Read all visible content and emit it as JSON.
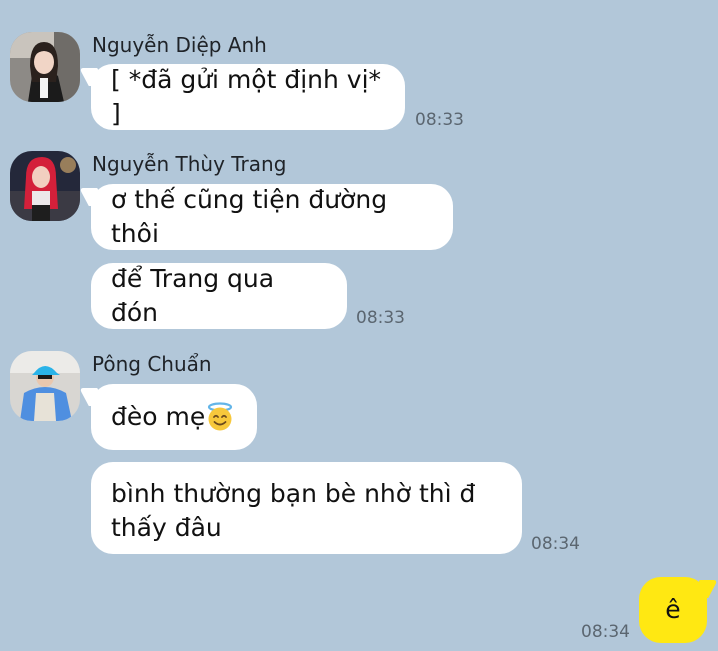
{
  "messages": [
    {
      "sender": "Nguyễn Diệp Anh",
      "avatar_icon": "avatar-diep-anh",
      "bubbles": [
        "[ *đã gửi một định vị* ]"
      ],
      "time": "08:33"
    },
    {
      "sender": "Nguyễn Thùy Trang",
      "avatar_icon": "avatar-thuy-trang",
      "bubbles": [
        "ơ thế cũng tiện đường thôi",
        "để Trang qua đón"
      ],
      "time": "08:33"
    },
    {
      "sender": "Pông Chuẩn",
      "avatar_icon": "avatar-pong-chuan",
      "bubbles": [
        "đèo mẹ",
        "bình thường bạn bè nhờ thì đ thấy đâu"
      ],
      "emoji": "smiling-face-with-halo",
      "time": "08:34"
    }
  ],
  "my_message": {
    "text": "ê",
    "time": "08:34"
  },
  "colors": {
    "background": "#b2c7d9",
    "incoming_bubble": "#ffffff",
    "outgoing_bubble": "#ffe812"
  }
}
